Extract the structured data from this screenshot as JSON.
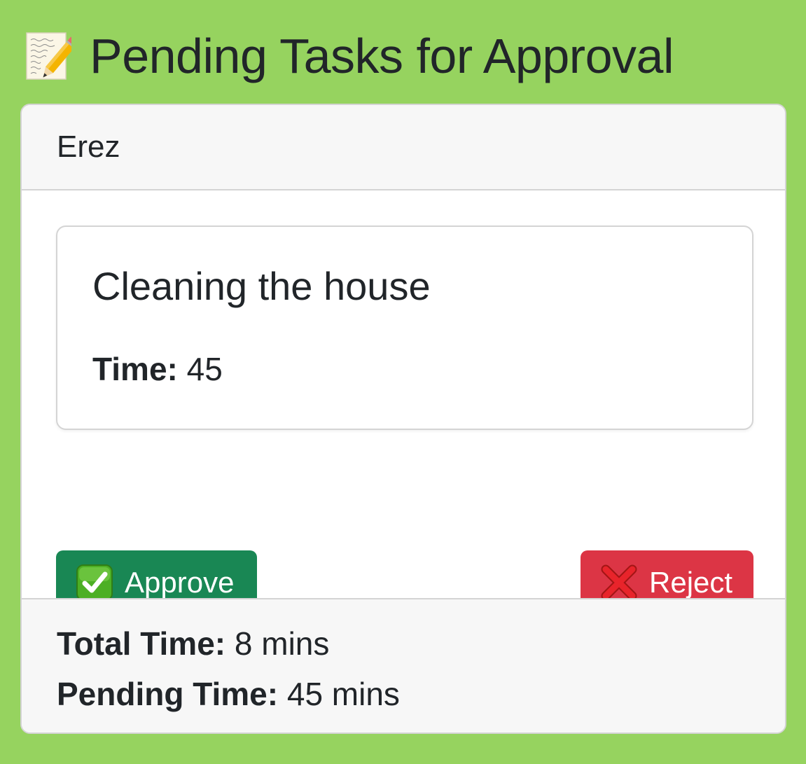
{
  "header": {
    "icon": "memo-icon",
    "title": "Pending Tasks for Approval"
  },
  "card": {
    "user_name": "Erez",
    "task": {
      "title": "Cleaning the house",
      "time_label": "Time:",
      "time_value": "45"
    },
    "actions": {
      "approve": {
        "icon": "check-mark-button-icon",
        "label": "Approve",
        "color": "#198754"
      },
      "reject": {
        "icon": "cross-mark-icon",
        "label": "Reject",
        "color": "#dc3545"
      }
    },
    "footer": {
      "total_label": "Total Time:",
      "total_value": "8 mins",
      "pending_label": "Pending Time:",
      "pending_value": "45 mins"
    }
  },
  "colors": {
    "page_background": "#96d35f",
    "card_header_background": "#f7f7f7",
    "text": "#212529"
  }
}
